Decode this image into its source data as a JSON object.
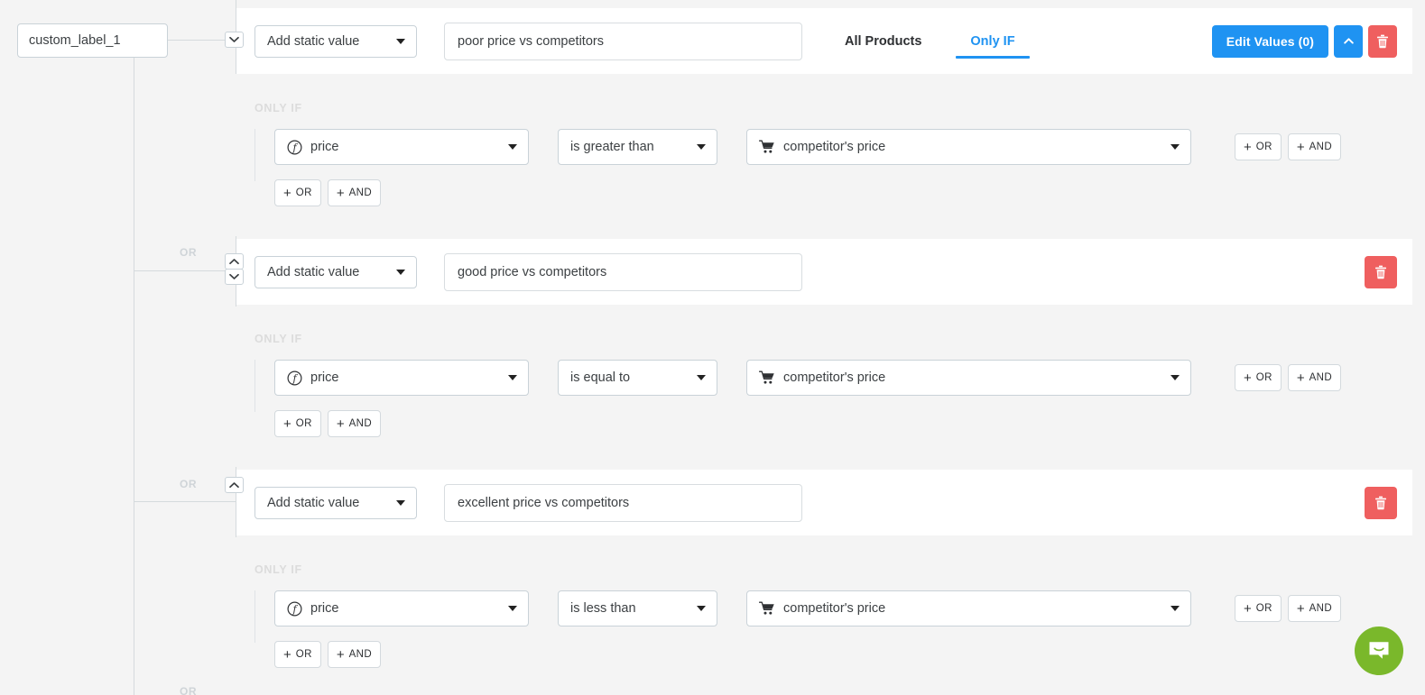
{
  "custom_label": {
    "value": "custom_label_1"
  },
  "tabs": [
    {
      "label": "All Products",
      "active": false
    },
    {
      "label": "Only IF",
      "active": true
    }
  ],
  "toolbar": {
    "edit_values_label": "Edit Values (0)",
    "collapse_icon": "chevron-up-icon",
    "delete_icon": "trash-icon"
  },
  "labels": {
    "only_if": "ONLY IF",
    "or_join": "OR",
    "add_or": "OR",
    "add_and": "AND",
    "plus": "+"
  },
  "colors": {
    "accent_blue": "#1f93f2",
    "danger_red": "#ef5f5f",
    "page_bg": "#f4f4f4",
    "panel_bg": "#ffffff",
    "muted_text": "#dcdcdc",
    "intercom_green": "#7ab82b"
  },
  "groups": [
    {
      "value_type": "Add static value",
      "value_text": "poor price vs competitors",
      "condition": {
        "field": "price",
        "field_icon": "function-f-icon",
        "operator": "is greater than",
        "value": "competitor's price",
        "value_icon": "shopping-cart-icon"
      }
    },
    {
      "value_type": "Add static value",
      "value_text": "good price vs competitors",
      "condition": {
        "field": "price",
        "field_icon": "function-f-icon",
        "operator": "is equal to",
        "value": "competitor's price",
        "value_icon": "shopping-cart-icon"
      }
    },
    {
      "value_type": "Add static value",
      "value_text": "excellent price vs competitors",
      "condition": {
        "field": "price",
        "field_icon": "function-f-icon",
        "operator": "is less than",
        "value": "competitor's price",
        "value_icon": "shopping-cart-icon"
      }
    }
  ]
}
